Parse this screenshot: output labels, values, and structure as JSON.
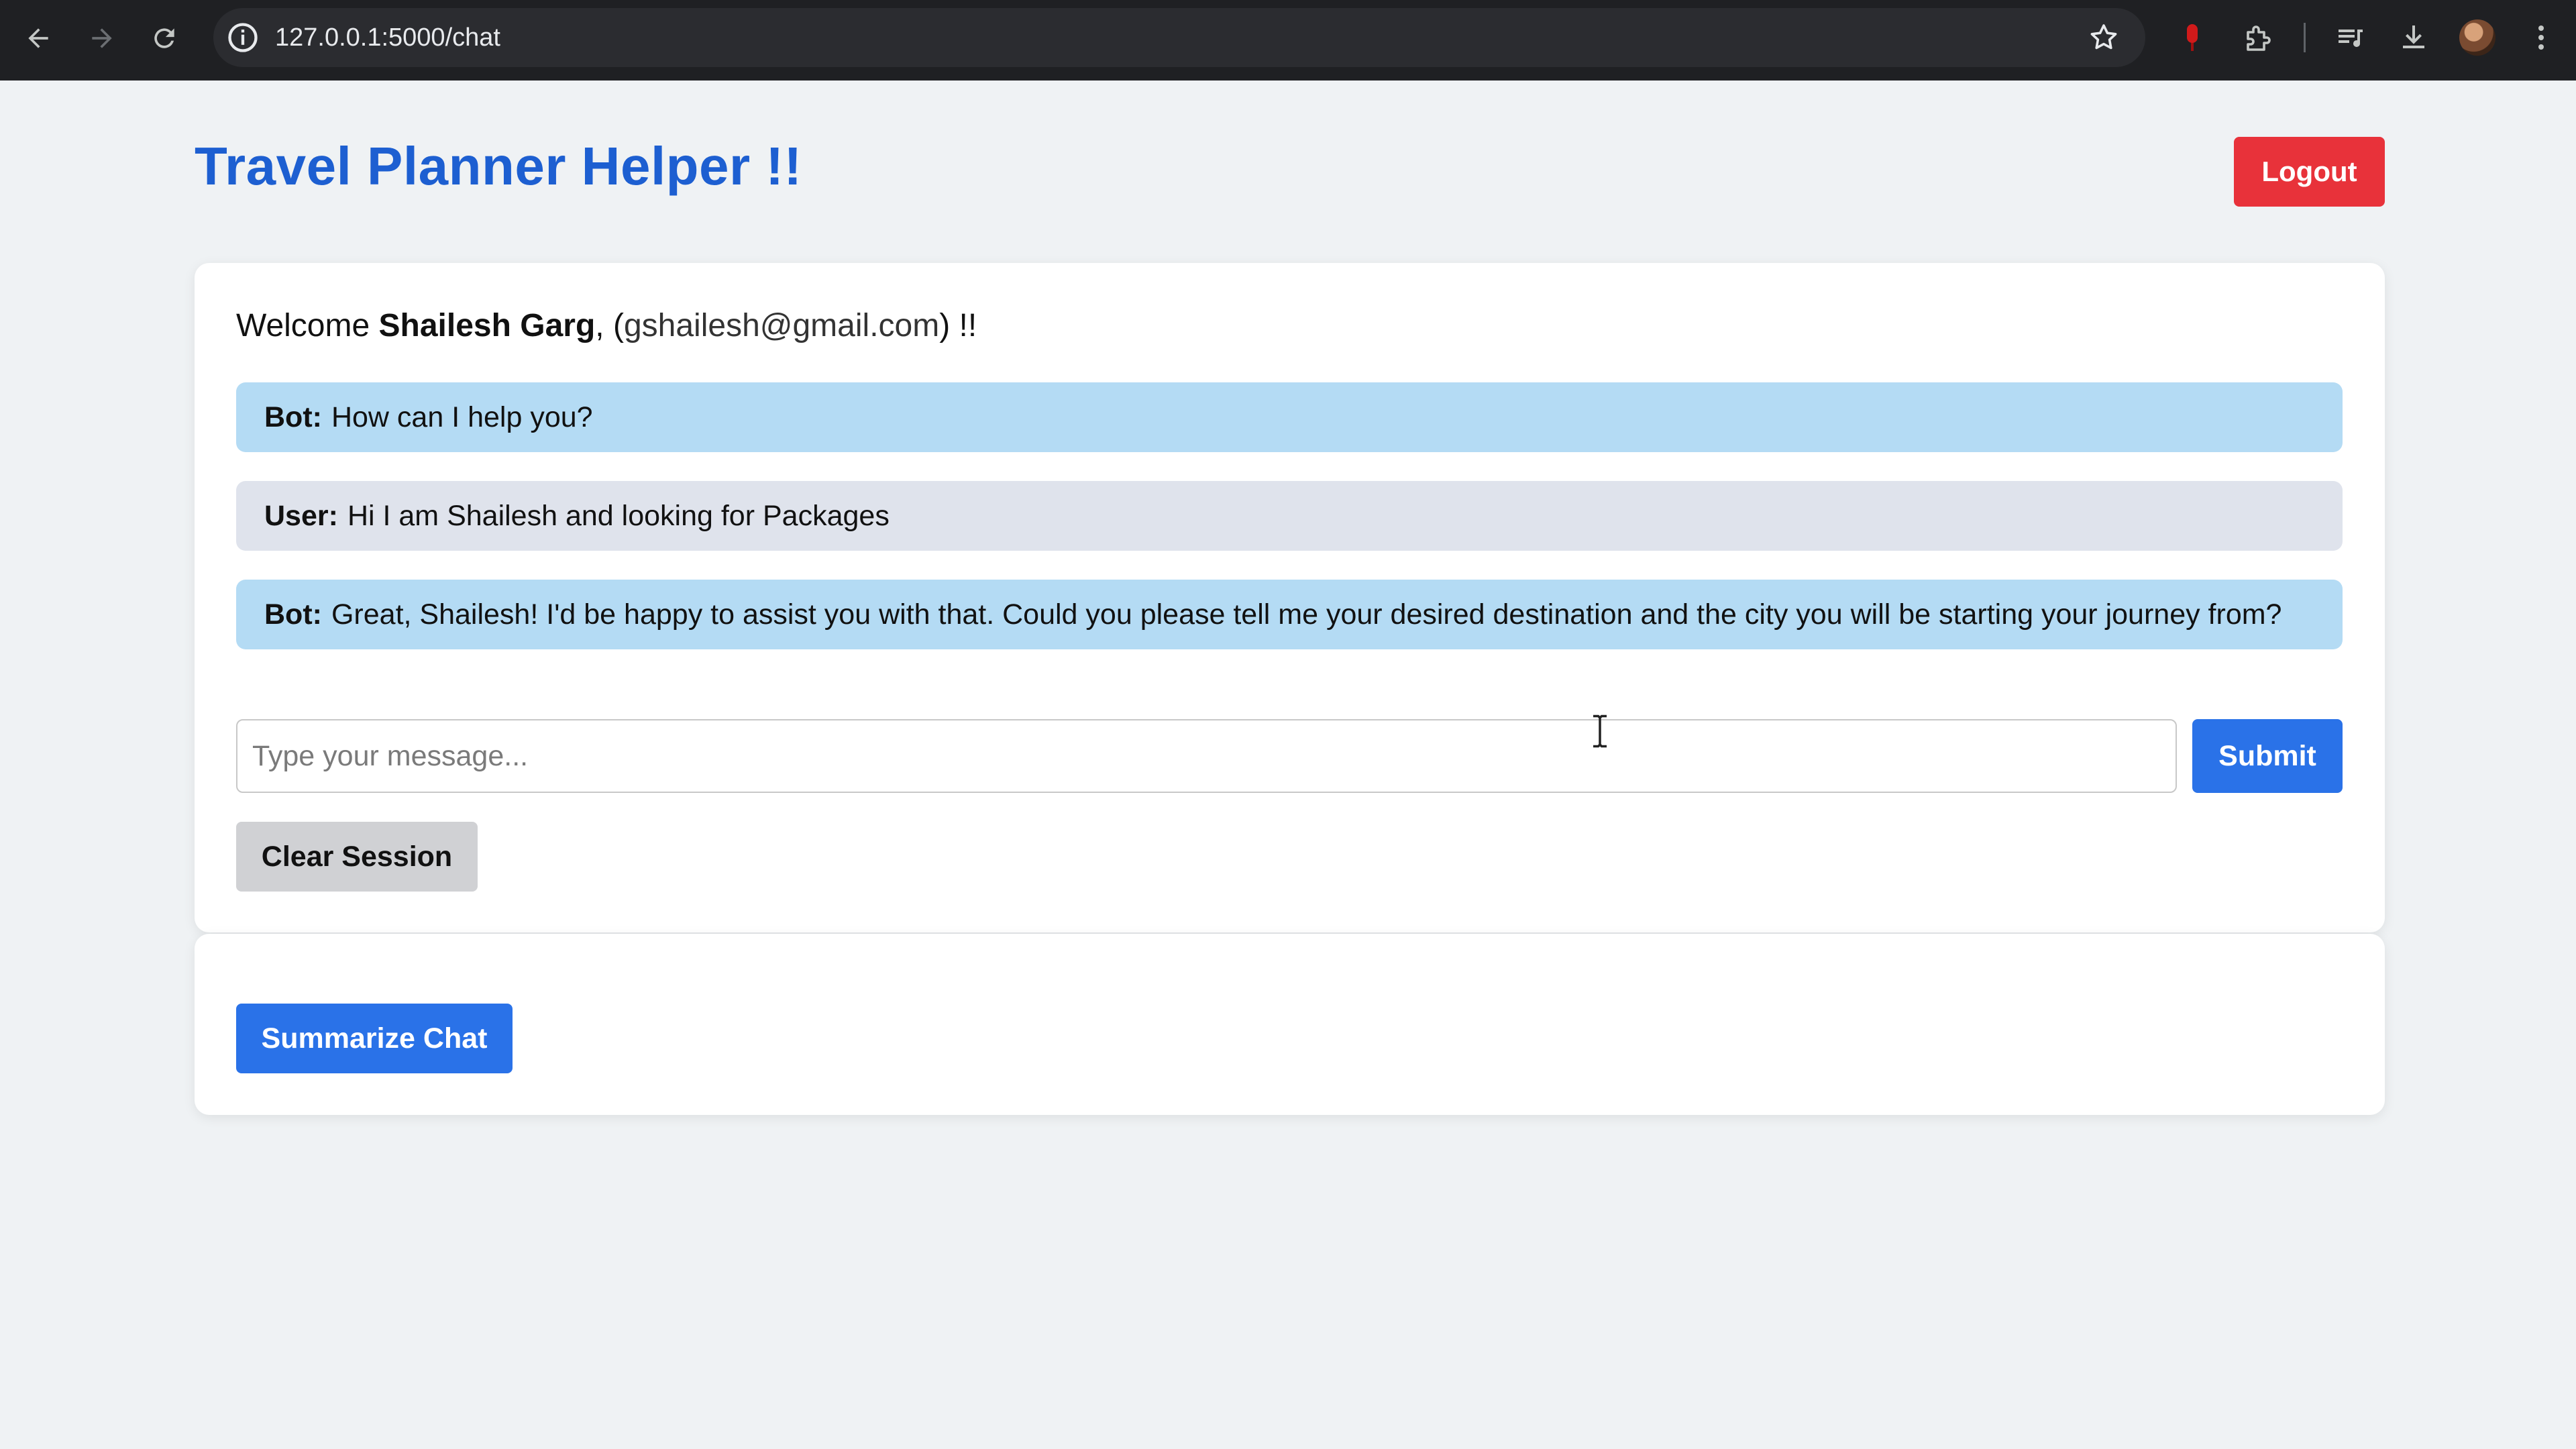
{
  "browser": {
    "url": "127.0.0.1:5000/chat",
    "icons": [
      "back-icon",
      "forward-icon",
      "reload-icon",
      "site-info-icon",
      "bookmark-star-icon",
      "extension-icon",
      "puzzle-icon",
      "media-queue-icon",
      "download-icon",
      "profile-avatar",
      "menu-icon"
    ]
  },
  "header": {
    "title": "Travel Planner Helper !!",
    "logout_label": "Logout"
  },
  "welcome": {
    "prefix": "Welcome ",
    "user_name": "Shailesh Garg",
    "email_open": ", (",
    "email": "gshailesh@gmail.com",
    "suffix": ") !!"
  },
  "messages": [
    {
      "speaker": "Bot:",
      "role": "bot",
      "text": "How can I help you?"
    },
    {
      "speaker": "User:",
      "role": "user",
      "text": "Hi I am Shailesh and looking for Packages"
    },
    {
      "speaker": "Bot:",
      "role": "bot",
      "text": "Great, Shailesh! I'd be happy to assist you with that. Could you please tell me your desired destination and the city you will be starting your journey from?"
    }
  ],
  "composer": {
    "value": "",
    "placeholder": "Type your message...",
    "submit_label": "Submit",
    "clear_label": "Clear Session"
  },
  "summary": {
    "summarize_label": "Summarize Chat"
  },
  "colors": {
    "title": "#1d5fd1",
    "logout": "#e8323a",
    "primary_button": "#2a72e8",
    "bot_bubble": "#b4dbf4",
    "user_bubble": "#dfe3ec",
    "clear_button": "#d0d1d4"
  }
}
